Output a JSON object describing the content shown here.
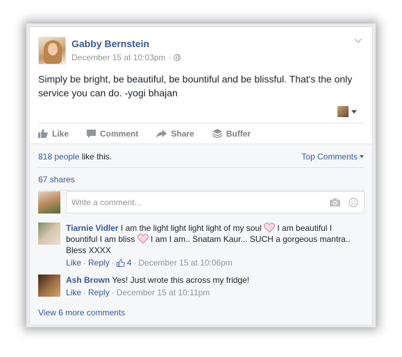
{
  "post": {
    "author": "Gabby Bernstein",
    "timestamp": "December 15 at 10:03pm",
    "separator": "·",
    "text": "Simply be bright, be beautiful, be bountiful and be blissful. That's the only service you can do. -yogi bhajan"
  },
  "actions": {
    "like": "Like",
    "comment": "Comment",
    "share": "Share",
    "buffer": "Buffer"
  },
  "ufi": {
    "likes_link": "818 people",
    "likes_rest": " like this.",
    "top_comments": "Top Comments",
    "shares": "67 shares",
    "comment_placeholder": "Write a comment...",
    "view_more": "View 6 more comments"
  },
  "comments": [
    {
      "author": "Tiarnie Vidler",
      "text_1": " I am the light light light light of my soul ",
      "text_2": " I am beautiful I bountiful I am bliss ",
      "text_3": " I am I am.. Snatam Kaur... SUCH a gorgeous mantra.. Bless XXXX",
      "like": "Like",
      "reply": "Reply",
      "like_count": "4",
      "time": "December 15 at 10:06pm"
    },
    {
      "author": "Ash Brown",
      "text_1": " Yes! Just wrote this across my fridge!",
      "like": "Like",
      "reply": "Reply",
      "time": "December 15 at 10:11pm"
    }
  ],
  "colors": {
    "link": "#365899",
    "muted": "#90949c",
    "action": "#7f7f7f",
    "ufi_bg": "#f6f7f9"
  }
}
